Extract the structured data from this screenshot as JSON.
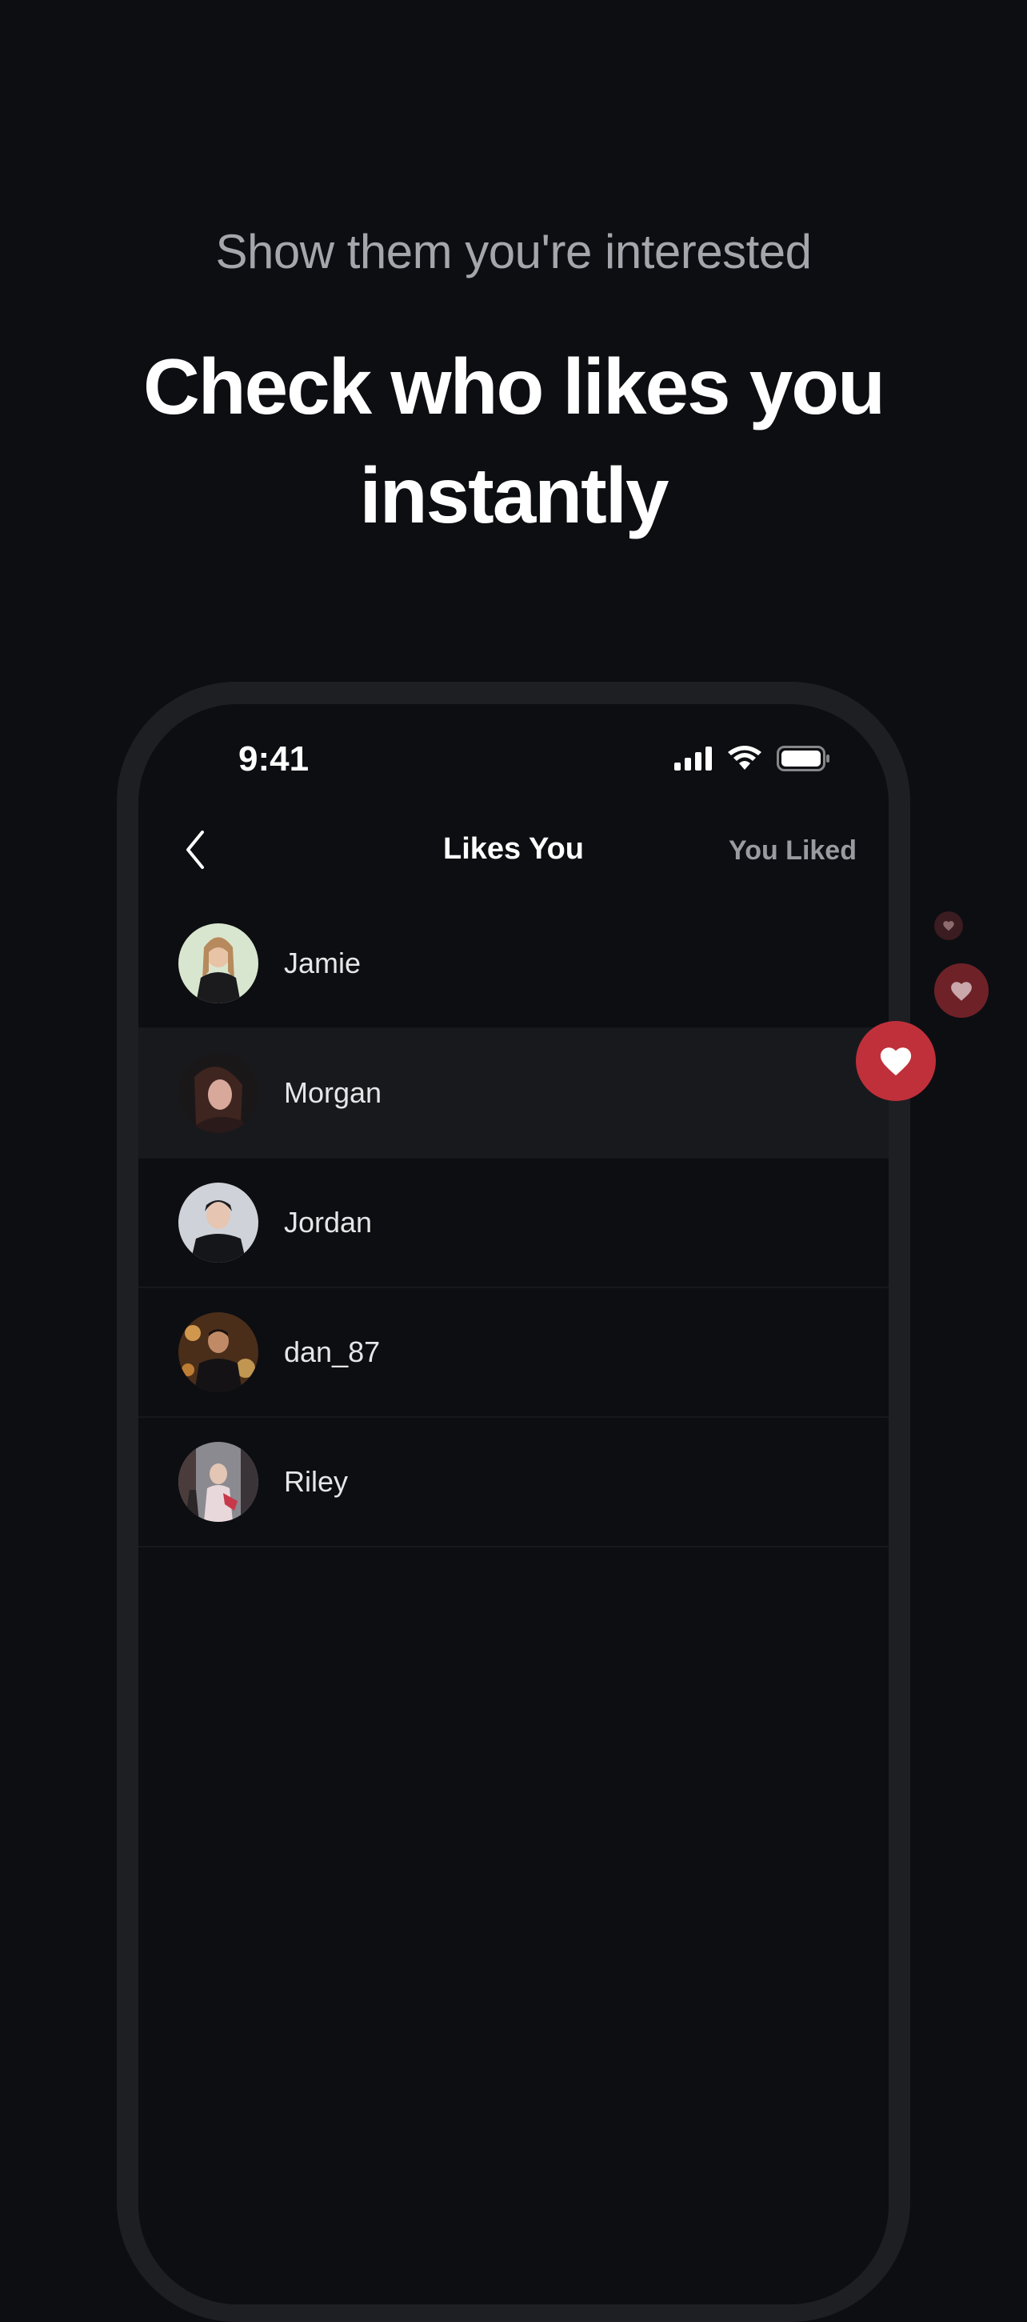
{
  "marketing": {
    "subtitle": "Show them you're interested",
    "headline": "Check who likes you instantly"
  },
  "status_bar": {
    "time": "9:41",
    "icons": [
      "cellular-signal-icon",
      "wifi-icon",
      "battery-icon"
    ]
  },
  "nav": {
    "back_icon": "chevron-left-icon",
    "title": "Likes You",
    "right_label": "You Liked"
  },
  "likes": [
    {
      "name": "Jamie"
    },
    {
      "name": "Morgan"
    },
    {
      "name": "Jordan"
    },
    {
      "name": "dan_87"
    },
    {
      "name": "Riley"
    }
  ],
  "decorations": {
    "heart_icon": "heart-icon",
    "accent_color": "#c0303a"
  },
  "colors": {
    "background": "#0d0e12",
    "frame": "#1e1f23",
    "highlight_row": "#18191d",
    "accent": "#c0303a"
  }
}
